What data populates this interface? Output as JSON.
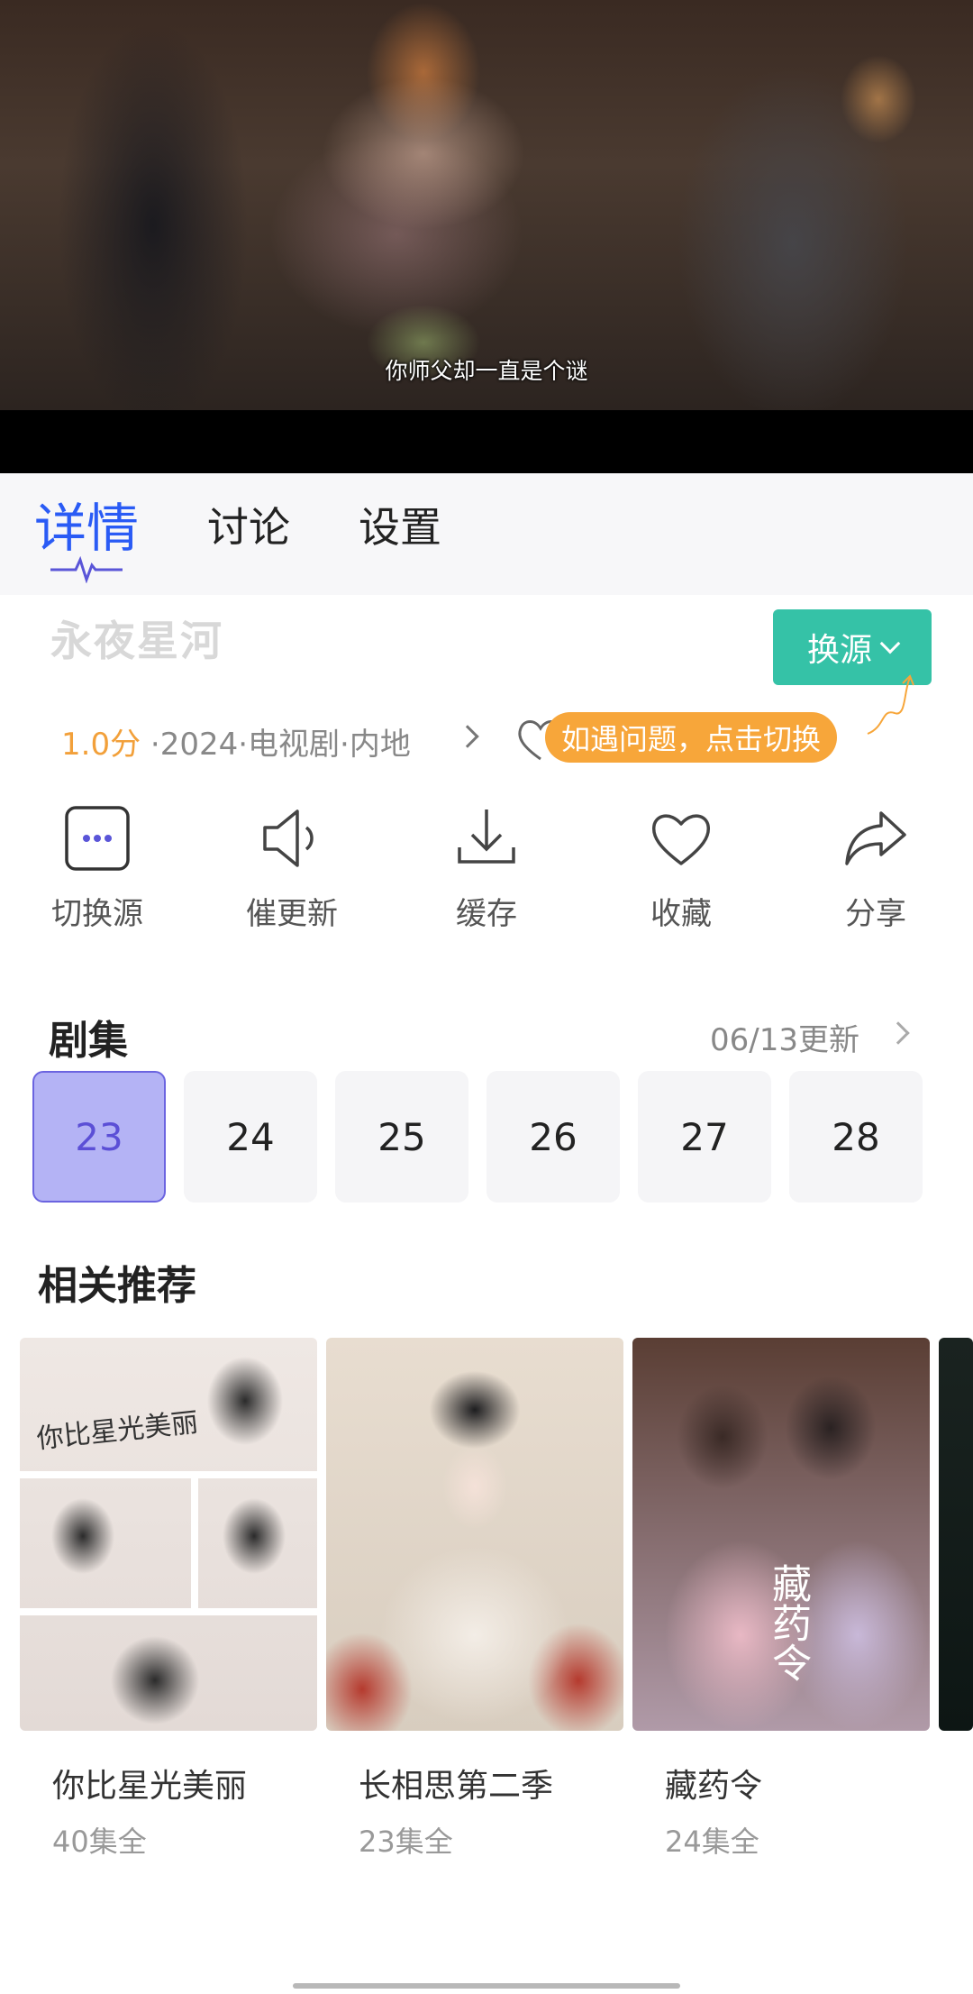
{
  "video": {
    "subtitle": "你师父却一直是个谜"
  },
  "tabs": [
    {
      "label": "详情",
      "active": true
    },
    {
      "label": "讨论",
      "active": false
    },
    {
      "label": "设置",
      "active": false
    }
  ],
  "show": {
    "title": "永夜星河",
    "score": "1.0分",
    "meta": " ·2024·电视剧·内地"
  },
  "source_button": {
    "label": "换源"
  },
  "tooltip": {
    "text": "如遇问题，点击切换"
  },
  "actions": [
    {
      "label": "切换源",
      "icon": "more-icon"
    },
    {
      "label": "催更新",
      "icon": "speaker-icon"
    },
    {
      "label": "缓存",
      "icon": "download-icon"
    },
    {
      "label": "收藏",
      "icon": "heart-icon"
    },
    {
      "label": "分享",
      "icon": "share-icon"
    }
  ],
  "episodes": {
    "title": "剧集",
    "update": "06/13更新",
    "items": [
      "23",
      "24",
      "25",
      "26",
      "27",
      "28"
    ],
    "current": "23"
  },
  "recommend": {
    "title": "相关推荐",
    "items": [
      {
        "title": "你比星光美丽",
        "count": "40集全",
        "poster_text": "你比星光美丽"
      },
      {
        "title": "长相思第二季",
        "count": "23集全"
      },
      {
        "title": "藏药令",
        "count": "24集全",
        "poster_text": "藏药令"
      }
    ]
  },
  "colors": {
    "accent": "#2a5bf5",
    "source_button": "#35c2a7",
    "score": "#f2a03a",
    "tooltip": "#f7a63a",
    "episode_current": "#b4b3f5"
  }
}
